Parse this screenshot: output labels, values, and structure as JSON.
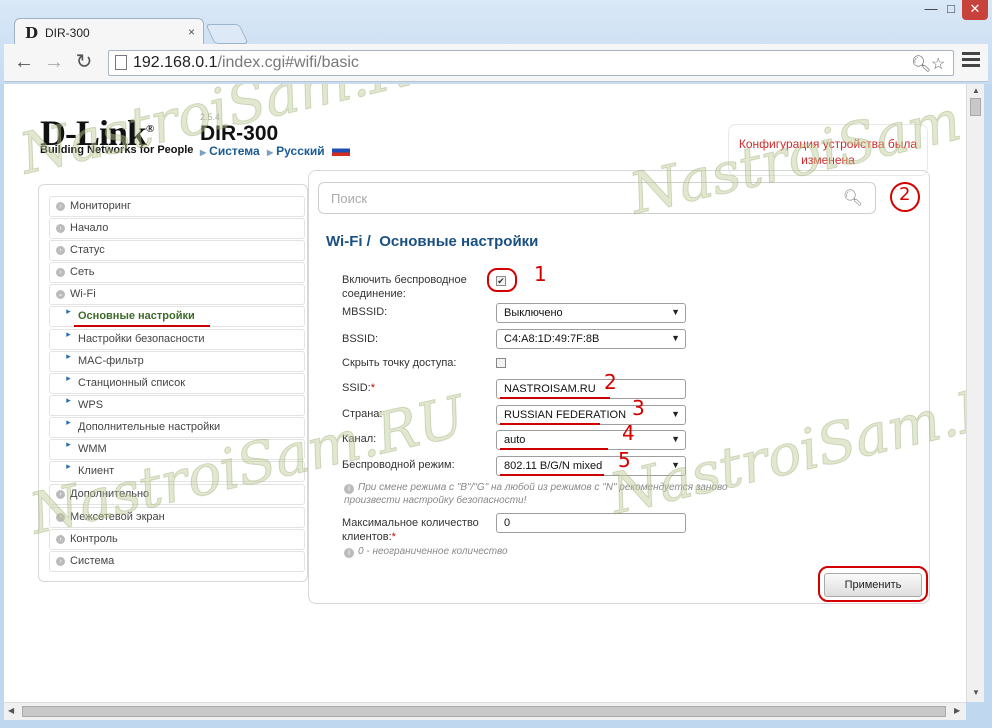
{
  "browser": {
    "tab_title": "DIR-300",
    "tab_favicon": "D",
    "close_tab": "×",
    "url_host": "192.168.0.1",
    "url_path": "/index.cgi#wifi/basic",
    "window_buttons": {
      "minimize": "—",
      "maximize": "□",
      "close": "✕"
    },
    "nav": {
      "back": "←",
      "forward": "→",
      "reload": "↻"
    },
    "icons": {
      "zoom": "zoom-icon",
      "star": "star-icon",
      "menu": "menu-icon"
    }
  },
  "header": {
    "brand": "D-Link",
    "trademark": "®",
    "tagline": "Building Networks for People",
    "version": "2.5.4",
    "model": "DIR-300",
    "crumb_system": "Система",
    "crumb_language": "Русский",
    "notice": "Конфигурация устройства была изменена"
  },
  "sidebar": {
    "items": [
      {
        "label": "Мониторинг"
      },
      {
        "label": "Начало"
      },
      {
        "label": "Статус"
      },
      {
        "label": "Сеть"
      },
      {
        "label": "Wi-Fi"
      },
      {
        "label": "Основные настройки"
      },
      {
        "label": "Настройки безопасности"
      },
      {
        "label": "MAC-фильтр"
      },
      {
        "label": "Станционный список"
      },
      {
        "label": "WPS"
      },
      {
        "label": "Дополнительные настройки"
      },
      {
        "label": "WMM"
      },
      {
        "label": "Клиент"
      },
      {
        "label": "Дополнительно"
      },
      {
        "label": "Межсетевой экран"
      },
      {
        "label": "Контроль"
      },
      {
        "label": "Система"
      }
    ]
  },
  "search": {
    "placeholder": "Поиск"
  },
  "main": {
    "title_section": "Wi-Fi /",
    "title_page": "Основные настройки",
    "enable_label": "Включить беспроводное соединение:",
    "enable_checked": "✔",
    "mbssid_label": "MBSSID:",
    "mbssid_value": "Выключено",
    "bssid_label": "BSSID:",
    "bssid_value": "C4:A8:1D:49:7F:8B",
    "hide_ap_label": "Скрыть точку доступа:",
    "ssid_label": "SSID:",
    "ssid_value": "NASTROISAM.RU",
    "country_label": "Страна:",
    "country_value": "RUSSIAN FEDERATION",
    "channel_label": "Канал:",
    "channel_value": "auto",
    "mode_label": "Беспроводной режим:",
    "mode_value": "802.11 B/G/N mixed",
    "mode_hint": "При смене режима с \"B\"/\"G\" на любой из режимов с \"N\" рекомендуется заново произвести настройку безопасности!",
    "max_clients_label": "Максимальное количество клиентов:",
    "max_clients_value": "0",
    "max_clients_hint": "0 - неограниченное количество",
    "required_mark": "*",
    "info_icon": "i",
    "apply_label": "Применить"
  },
  "annotations": {
    "n1": "1",
    "n2": "2",
    "n3": "3",
    "n4": "4",
    "n5": "5",
    "n_notice": "2"
  },
  "watermark": "NastroiSam.RU",
  "colors": {
    "annotation": "#d40000",
    "title": "#1a5082",
    "notice": "#d12b2b",
    "active_menu": "#3d6b2a"
  }
}
